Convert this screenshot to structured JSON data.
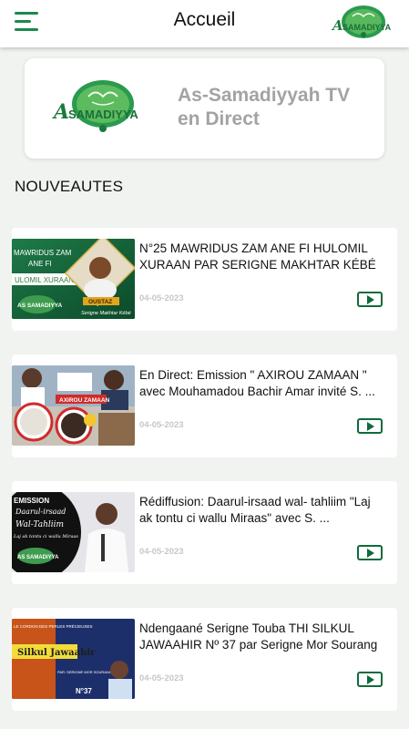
{
  "header": {
    "title": "Accueil",
    "menu_icon": "hamburger-menu-icon",
    "logo_text": "AS SAMADIYYA",
    "accent": "#1a8a4a"
  },
  "live": {
    "title": "As-Samadiyyah TV en Direct",
    "logo_text": "AS SAMADIYYA"
  },
  "section": {
    "heading": "NOUVEAUTES"
  },
  "videos": [
    {
      "title": "N°25 MAWRIDUS ZAM ANE FI HULOMIL XURAAN PAR SERIGNE MAKHTAR KÉBÉ ...",
      "date": "04-05-2023",
      "thumb": {
        "line1": "MAWRIDUS ZAM",
        "line2": "ANE FI",
        "line3": "ULOMIL XURAAN",
        "badge": "OUSTAZ",
        "caption": "Serigne Makhtar Kébé",
        "logo": "AS SAMADIYYA"
      }
    },
    {
      "title": "En Direct: Emission \" AXIROU ZAMAAN \" avec Mouhamadou Bachir Amar invité S. ...",
      "date": "04-05-2023",
      "thumb": {
        "line1": "AXIROU ZAMAAN"
      }
    },
    {
      "title": "Rédiffusion: Daarul-irsaad wal- tahliim \"Laj ak tontu ci wallu Miraas\" avec S. ...",
      "date": "04-05-2023",
      "thumb": {
        "line1": "EMISSION",
        "line2": "Daarul-irsaad",
        "line3": "Wal-Tahliim",
        "line4": "Laj ak tontu ci wallu Miraas",
        "logo": "AS SAMADIYYA"
      }
    },
    {
      "title": "Ndengaané Serigne Touba THI SILKUL JAWAAHIR Nº 37 par Serigne Mor Sourang",
      "date": "04-05-2023",
      "thumb": {
        "line1": "LE CORDON DES PERLES PRÉCIEUSES",
        "line2": "Silkul Jawaahir",
        "line3": "N°37",
        "line4": "PAR: SERIGNE MOR SOURANG"
      }
    }
  ]
}
